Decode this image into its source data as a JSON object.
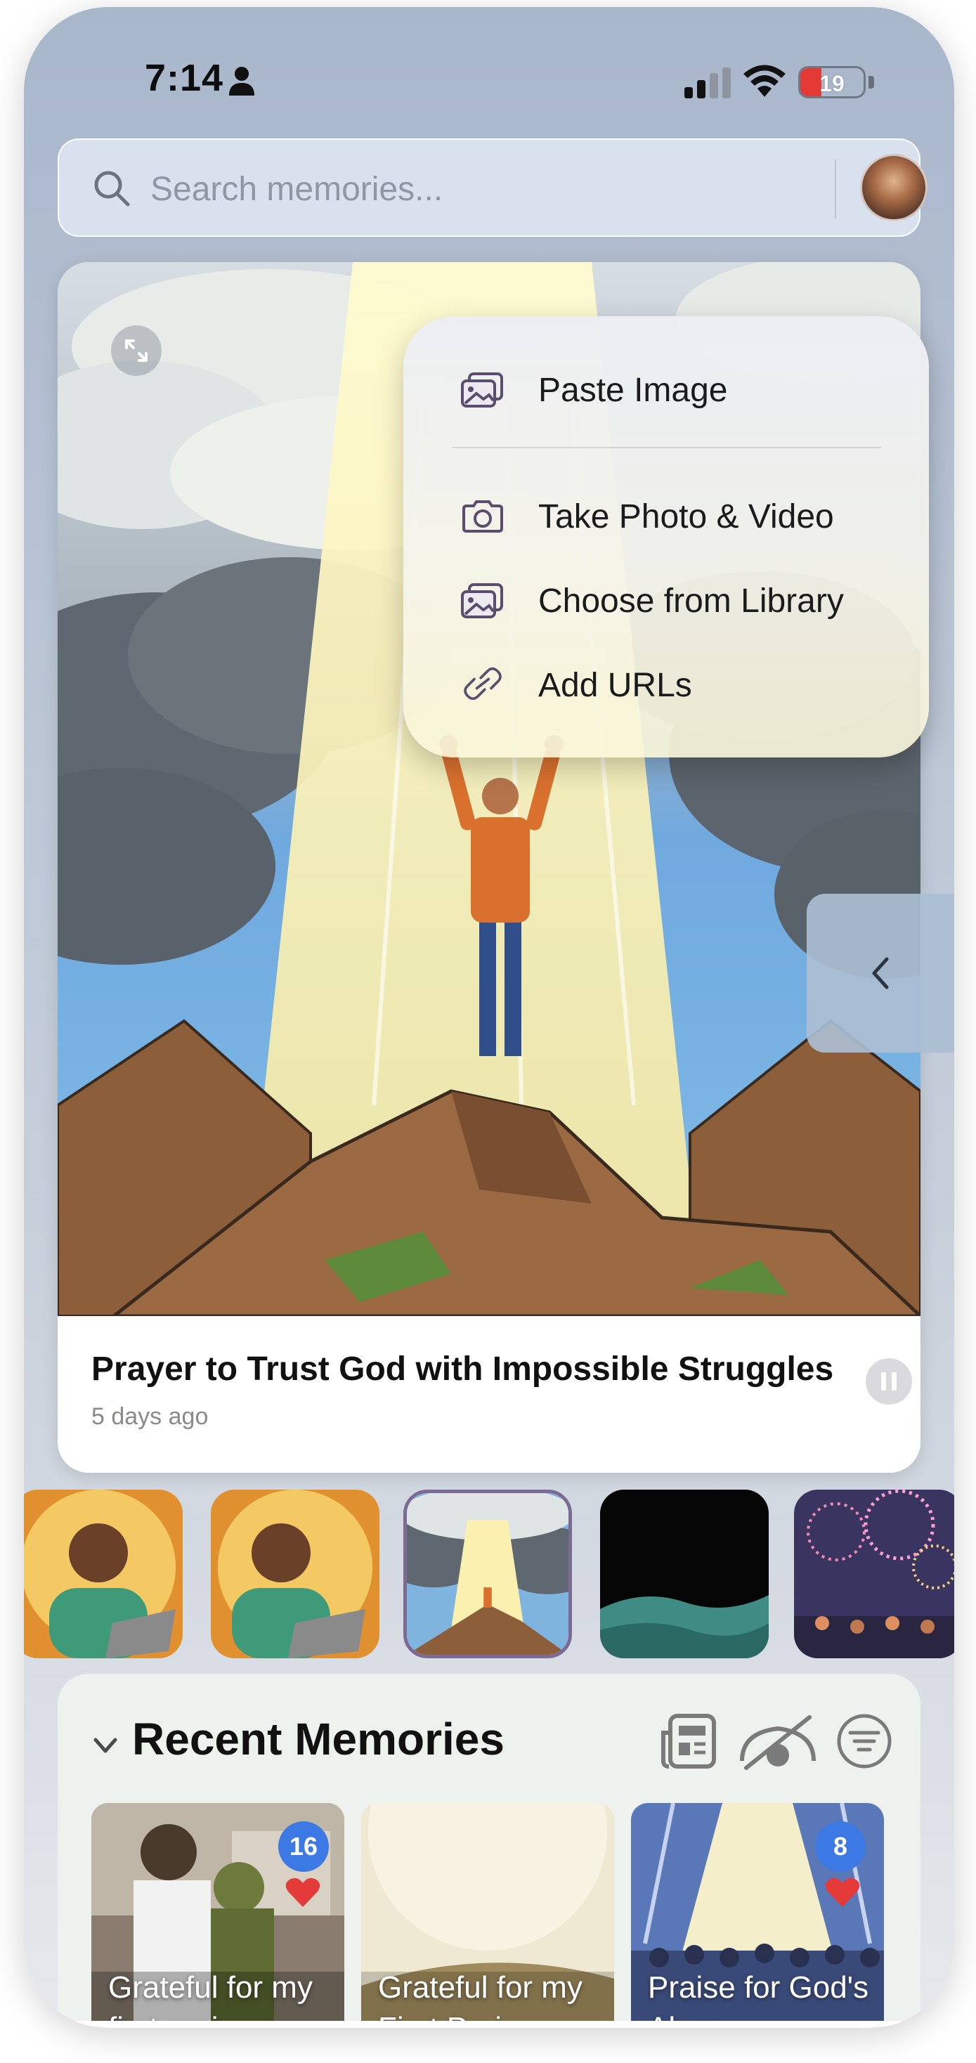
{
  "status_bar": {
    "time": "7:14",
    "battery_level": "19",
    "battery_color": "#e53935"
  },
  "search": {
    "placeholder": "Search memories..."
  },
  "featured": {
    "title": "Prayer to Trust God with Impossible Struggles",
    "time_ago": "5 days ago"
  },
  "popup_menu": {
    "items": [
      {
        "label": "Paste Image",
        "icon": "image-icon"
      },
      {
        "label": "Take Photo & Video",
        "icon": "camera-icon"
      },
      {
        "label": "Choose from Library",
        "icon": "photo-library-icon"
      },
      {
        "label": "Add URLs",
        "icon": "link-icon"
      }
    ]
  },
  "recent": {
    "title": "Recent Memories",
    "cards": [
      {
        "label": "Grateful for my first prai...",
        "count": "16",
        "favorited": true
      },
      {
        "label": "Grateful for my First Prai...",
        "count": "",
        "favorited": false
      },
      {
        "label": "Praise for God's Abun...",
        "count": "8",
        "favorited": true
      }
    ]
  },
  "colors": {
    "accent_badge": "#3c79e4",
    "heart": "#e53a3a",
    "selected_thumb_border": "#7a6a94"
  }
}
